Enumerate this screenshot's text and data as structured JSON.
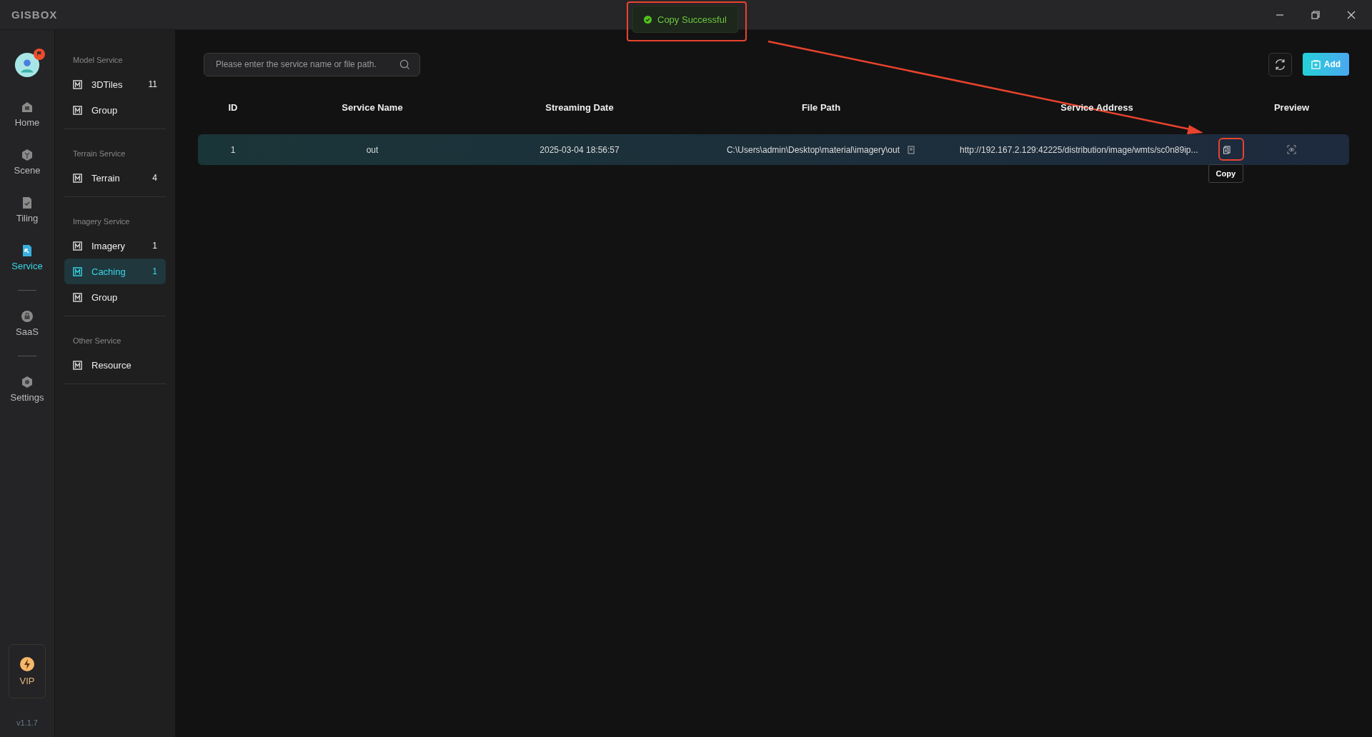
{
  "app": {
    "logo": "GISBOX"
  },
  "toast": {
    "message": "Copy Successful"
  },
  "rail": {
    "items": [
      {
        "kind": "nav",
        "label": "Home",
        "selected": false
      },
      {
        "kind": "nav",
        "label": "Scene",
        "selected": false
      },
      {
        "kind": "nav",
        "label": "Tiling",
        "selected": false
      },
      {
        "kind": "nav",
        "label": "Service",
        "selected": true
      },
      {
        "kind": "divider"
      },
      {
        "kind": "nav",
        "label": "SaaS",
        "selected": false
      },
      {
        "kind": "divider"
      },
      {
        "kind": "nav",
        "label": "Settings",
        "selected": false
      }
    ],
    "vip": "VIP",
    "version": "v1.1.7"
  },
  "sidebar": {
    "sections": [
      {
        "title": "Model Service",
        "items": [
          {
            "label": "3DTiles",
            "count": "11",
            "selected": false
          },
          {
            "label": "Group",
            "selected": false
          }
        ]
      },
      {
        "title": "Terrain Service",
        "items": [
          {
            "label": "Terrain",
            "count": "4",
            "selected": false
          }
        ]
      },
      {
        "title": "Imagery Service",
        "items": [
          {
            "label": "Imagery",
            "count": "1",
            "selected": false
          },
          {
            "label": "Caching",
            "count": "1",
            "selected": true
          },
          {
            "label": "Group",
            "selected": false
          }
        ]
      },
      {
        "title": "Other Service",
        "items": [
          {
            "label": "Resource",
            "selected": false
          }
        ]
      }
    ]
  },
  "search": {
    "placeholder": "Please enter the service name or file path."
  },
  "add_button": "Add",
  "table": {
    "columns": [
      "ID",
      "Service Name",
      "Streaming Date",
      "File Path",
      "Service Address",
      "Preview"
    ],
    "rows": [
      {
        "id": "1",
        "name": "out",
        "date": "2025-03-04 18:56:57",
        "file_path": "C:\\Users\\admin\\Desktop\\material\\imagery\\out",
        "address": "http://192.167.2.129:42225/distribution/image/wmts/sc0n89ip..."
      }
    ]
  },
  "tooltip": "Copy"
}
